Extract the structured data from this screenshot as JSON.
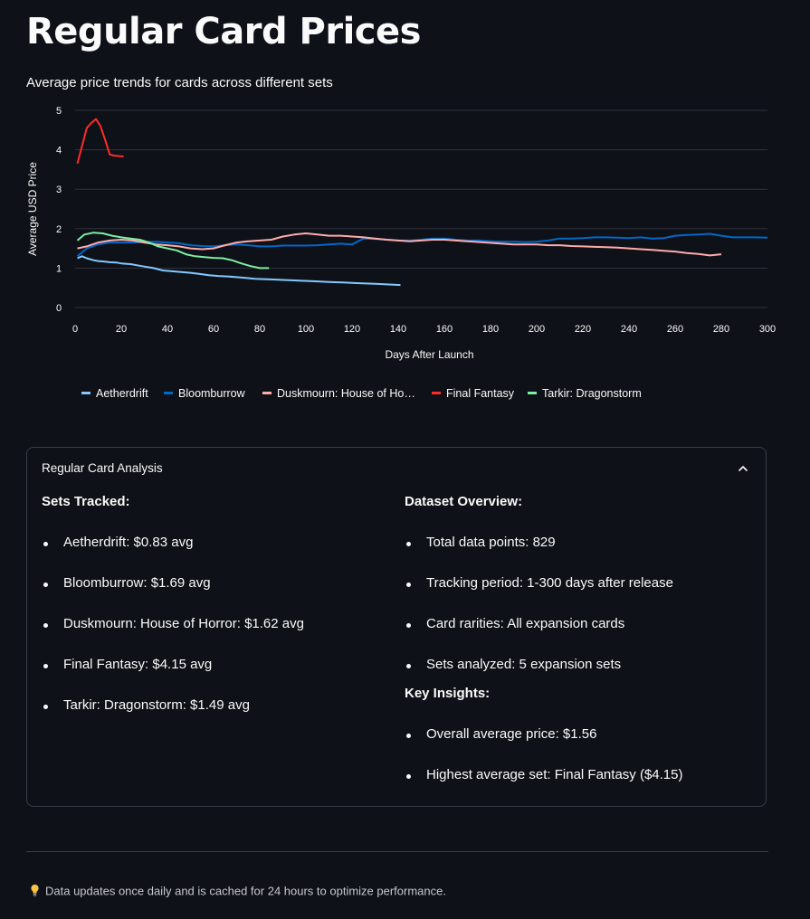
{
  "page": {
    "title": "Regular Card Prices",
    "subtitle": "Average price trends for cards across different sets"
  },
  "chart_data": {
    "type": "line",
    "xlabel": "Days After Launch",
    "ylabel": "Average USD Price",
    "xlim": [
      0,
      300
    ],
    "ylim": [
      0,
      5
    ],
    "xticks": [
      0,
      20,
      40,
      60,
      80,
      100,
      120,
      140,
      160,
      180,
      200,
      220,
      240,
      260,
      280,
      300
    ],
    "yticks": [
      0,
      1,
      2,
      3,
      4,
      5
    ],
    "grid": "horizontal",
    "legend_position": "bottom",
    "series": [
      {
        "name": "Aetherdrift",
        "legend_label": "Aetherdrift",
        "color": "#83c9ff",
        "x": [
          1,
          3,
          5,
          8,
          10,
          12,
          15,
          18,
          20,
          24,
          28,
          30,
          34,
          38,
          42,
          46,
          50,
          54,
          58,
          62,
          66,
          70,
          74,
          78,
          82,
          86,
          90,
          94,
          98,
          102,
          106,
          110,
          114,
          118,
          122,
          126,
          130,
          134,
          138,
          141
        ],
        "y": [
          1.25,
          1.3,
          1.25,
          1.2,
          1.18,
          1.17,
          1.15,
          1.14,
          1.12,
          1.1,
          1.06,
          1.04,
          1.0,
          0.94,
          0.92,
          0.9,
          0.88,
          0.85,
          0.82,
          0.8,
          0.79,
          0.77,
          0.75,
          0.73,
          0.72,
          0.71,
          0.7,
          0.69,
          0.68,
          0.67,
          0.66,
          0.65,
          0.64,
          0.63,
          0.62,
          0.61,
          0.6,
          0.59,
          0.58,
          0.57
        ]
      },
      {
        "name": "Bloomburrow",
        "legend_label": "Bloomburrow",
        "color": "#0068c9",
        "x": [
          1,
          5,
          10,
          15,
          20,
          25,
          30,
          35,
          40,
          45,
          50,
          55,
          60,
          65,
          70,
          75,
          80,
          85,
          90,
          95,
          100,
          105,
          110,
          115,
          120,
          125,
          130,
          135,
          140,
          145,
          150,
          155,
          160,
          165,
          170,
          175,
          180,
          185,
          190,
          195,
          200,
          205,
          210,
          215,
          220,
          225,
          230,
          235,
          240,
          245,
          250,
          255,
          260,
          265,
          270,
          275,
          280,
          285,
          290,
          295,
          300
        ],
        "y": [
          1.3,
          1.5,
          1.6,
          1.65,
          1.65,
          1.65,
          1.66,
          1.67,
          1.65,
          1.63,
          1.58,
          1.56,
          1.55,
          1.58,
          1.6,
          1.58,
          1.55,
          1.55,
          1.57,
          1.57,
          1.57,
          1.58,
          1.6,
          1.62,
          1.6,
          1.75,
          1.74,
          1.72,
          1.7,
          1.7,
          1.72,
          1.75,
          1.75,
          1.72,
          1.7,
          1.7,
          1.68,
          1.67,
          1.67,
          1.66,
          1.67,
          1.7,
          1.75,
          1.75,
          1.76,
          1.78,
          1.78,
          1.77,
          1.76,
          1.78,
          1.75,
          1.76,
          1.82,
          1.84,
          1.85,
          1.87,
          1.82,
          1.78,
          1.78,
          1.78,
          1.77
        ]
      },
      {
        "name": "Duskmourn: House of Horror",
        "legend_label": "Duskmourn: House of Ho…",
        "color": "#ffabab",
        "x": [
          1,
          5,
          10,
          15,
          20,
          25,
          30,
          35,
          40,
          45,
          50,
          55,
          60,
          65,
          70,
          75,
          80,
          85,
          90,
          95,
          100,
          105,
          110,
          115,
          120,
          125,
          130,
          135,
          140,
          145,
          150,
          155,
          160,
          165,
          170,
          175,
          180,
          185,
          190,
          195,
          200,
          205,
          210,
          215,
          220,
          225,
          230,
          235,
          240,
          245,
          250,
          255,
          260,
          265,
          270,
          275,
          280
        ],
        "y": [
          1.5,
          1.55,
          1.65,
          1.7,
          1.72,
          1.7,
          1.65,
          1.6,
          1.58,
          1.55,
          1.5,
          1.48,
          1.5,
          1.58,
          1.65,
          1.68,
          1.7,
          1.72,
          1.8,
          1.85,
          1.88,
          1.85,
          1.82,
          1.82,
          1.8,
          1.78,
          1.75,
          1.72,
          1.7,
          1.68,
          1.7,
          1.72,
          1.72,
          1.7,
          1.68,
          1.66,
          1.64,
          1.62,
          1.6,
          1.6,
          1.6,
          1.58,
          1.58,
          1.56,
          1.55,
          1.54,
          1.53,
          1.52,
          1.5,
          1.48,
          1.46,
          1.44,
          1.42,
          1.38,
          1.36,
          1.32,
          1.35
        ]
      },
      {
        "name": "Final Fantasy",
        "legend_label": "Final Fantasy",
        "color": "#ff2b2b",
        "x": [
          1,
          3,
          5,
          7,
          9,
          11,
          13,
          15,
          17,
          19,
          21
        ],
        "y": [
          3.65,
          4.1,
          4.55,
          4.68,
          4.78,
          4.6,
          4.25,
          3.88,
          3.85,
          3.84,
          3.83
        ]
      },
      {
        "name": "Tarkir: Dragonstorm",
        "legend_label": "Tarkir: Dragonstorm",
        "color": "#7defa1",
        "x": [
          1,
          4,
          8,
          12,
          16,
          20,
          24,
          28,
          32,
          36,
          40,
          44,
          48,
          52,
          56,
          60,
          64,
          68,
          72,
          76,
          80,
          84
        ],
        "y": [
          1.7,
          1.85,
          1.9,
          1.88,
          1.82,
          1.78,
          1.75,
          1.72,
          1.65,
          1.55,
          1.5,
          1.45,
          1.35,
          1.3,
          1.28,
          1.26,
          1.25,
          1.2,
          1.12,
          1.05,
          1.0,
          1.0
        ]
      }
    ]
  },
  "analysis": {
    "header": "Regular Card Analysis",
    "left": {
      "heading": "Sets Tracked:",
      "items": [
        "Aetherdrift: $0.83 avg",
        "Bloomburrow: $1.69 avg",
        "Duskmourn: House of Horror: $1.62 avg",
        "Final Fantasy: $4.15 avg",
        "Tarkir: Dragonstorm: $1.49 avg"
      ]
    },
    "right": {
      "overview_heading": "Dataset Overview:",
      "overview_items": [
        "Total data points: 829",
        "Tracking period: 1-300 days after release",
        "Card rarities: All expansion cards",
        "Sets analyzed: 5 expansion sets"
      ],
      "insights_heading": "Key Insights:",
      "insights_items": [
        "Overall average price: $1.56",
        "Highest average set: Final Fantasy ($4.15)"
      ]
    }
  },
  "footer": {
    "icon": "lightbulb-icon",
    "text": "Data updates once daily and is cached for 24 hours to optimize performance."
  },
  "colors": {
    "background": "#0e1117",
    "text": "#fafafa",
    "border": "#3a3d48"
  }
}
